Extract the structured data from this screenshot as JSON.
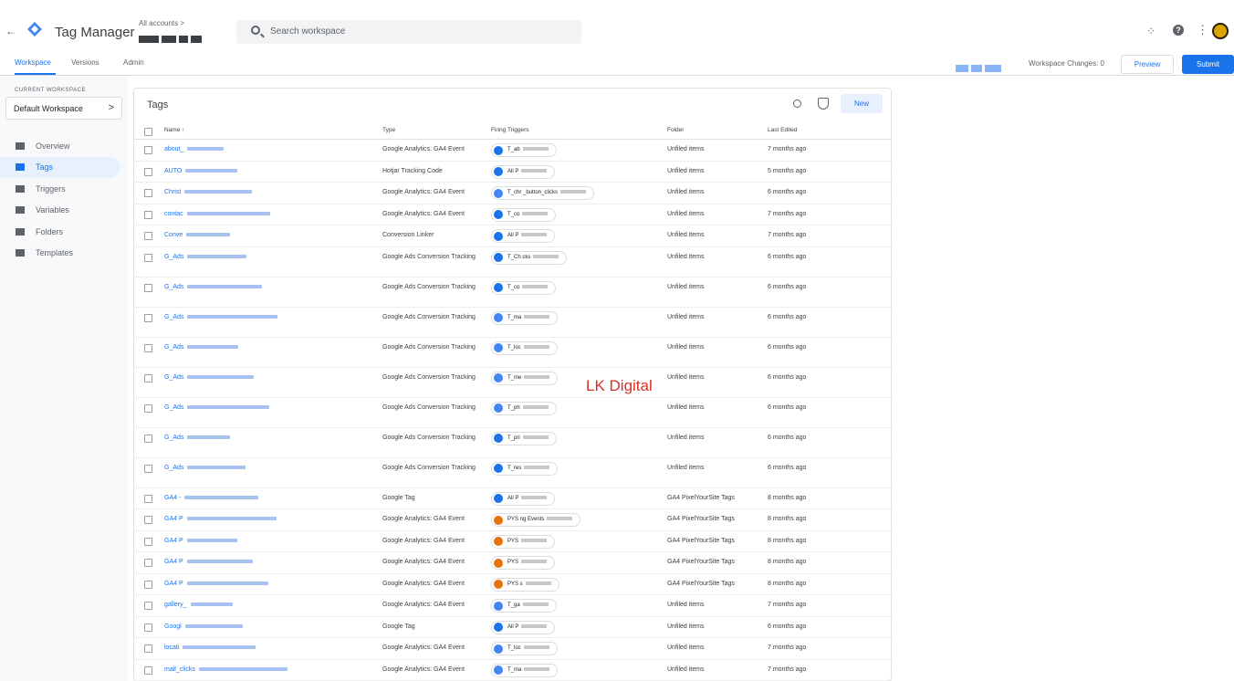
{
  "topbar": {
    "back_glyph": "←",
    "product_name": "Tag Manager",
    "account_path": "All accounts >",
    "search_placeholder": "Search workspace",
    "icons": [
      "back-arrow-icon",
      "tag-manager-logo",
      "search-icon",
      "apps-grid-icon",
      "help-icon",
      "more-vert-icon",
      "account-avatar"
    ]
  },
  "nav": {
    "tabs": [
      "Workspace",
      "Versions",
      "Admin"
    ],
    "active_tab": "Workspace",
    "workspace_changes": "Workspace Changes: 0",
    "preview_label": "Preview",
    "submit_label": "Submit"
  },
  "sidebar": {
    "current_workspace_label": "CURRENT WORKSPACE",
    "workspace_name": "Default Workspace",
    "chevron": ">",
    "items": [
      {
        "label": "Overview",
        "icon": "overview-icon",
        "active": false
      },
      {
        "label": "Tags",
        "icon": "tag-icon",
        "active": true
      },
      {
        "label": "Triggers",
        "icon": "trigger-icon",
        "active": false
      },
      {
        "label": "Variables",
        "icon": "variables-icon",
        "active": false
      },
      {
        "label": "Folders",
        "icon": "folder-icon",
        "active": false
      },
      {
        "label": "Templates",
        "icon": "template-icon",
        "active": false
      }
    ]
  },
  "panel": {
    "title": "Tags",
    "new_label": "New",
    "columns": [
      "Name ↑",
      "Type",
      "Firing Triggers",
      "Folder",
      "Last Edited"
    ]
  },
  "rows": [
    {
      "name": "about_",
      "type": "Google Analytics: GA4 Event",
      "trigger": "T_ab",
      "trigger_color": "blue",
      "folder": "Unfiled items",
      "edited": "7 months ago",
      "tall": false
    },
    {
      "name": "AUTO",
      "type": "Hotjar Tracking Code",
      "trigger": "All P",
      "trigger_color": "blue",
      "folder": "Unfiled items",
      "edited": "5 months ago",
      "tall": false
    },
    {
      "name": "Christ",
      "type": "Google Analytics: GA4 Event",
      "trigger": "T_chr _button_clicks",
      "trigger_color": "light",
      "folder": "Unfiled items",
      "edited": "6 months ago",
      "tall": false
    },
    {
      "name": "contac",
      "type": "Google Analytics: GA4 Event",
      "trigger": "T_co",
      "trigger_color": "blue",
      "folder": "Unfiled items",
      "edited": "7 months ago",
      "tall": false
    },
    {
      "name": "Conve",
      "type": "Conversion Linker",
      "trigger": "All P",
      "trigger_color": "blue",
      "folder": "Unfiled items",
      "edited": "7 months ago",
      "tall": false
    },
    {
      "name": "G_Ads",
      "type": "Google Ads Conversion Tracking",
      "trigger": "T_Ch cks",
      "trigger_color": "blue",
      "folder": "Unfiled items",
      "edited": "6 months ago",
      "tall": true
    },
    {
      "name": "G_Ads",
      "type": "Google Ads Conversion Tracking",
      "trigger": "T_co",
      "trigger_color": "blue",
      "folder": "Unfiled items",
      "edited": "6 months ago",
      "tall": true
    },
    {
      "name": "G_Ads",
      "type": "Google Ads Conversion Tracking",
      "trigger": "T_ma",
      "trigger_color": "light",
      "folder": "Unfiled items",
      "edited": "6 months ago",
      "tall": true
    },
    {
      "name": "G_Ads",
      "type": "Google Ads Conversion Tracking",
      "trigger": "T_loc",
      "trigger_color": "light",
      "folder": "Unfiled items",
      "edited": "6 months ago",
      "tall": true
    },
    {
      "name": "G_Ads",
      "type": "Google Ads Conversion Tracking",
      "trigger": "T_me",
      "trigger_color": "light",
      "folder": "Unfiled items",
      "edited": "6 months ago",
      "tall": true
    },
    {
      "name": "G_Ads",
      "type": "Google Ads Conversion Tracking",
      "trigger": "T_ph",
      "trigger_color": "light",
      "folder": "Unfiled items",
      "edited": "6 months ago",
      "tall": true
    },
    {
      "name": "G_Ads",
      "type": "Google Ads Conversion Tracking",
      "trigger": "T_pri",
      "trigger_color": "blue",
      "folder": "Unfiled items",
      "edited": "6 months ago",
      "tall": true
    },
    {
      "name": "G_Ads",
      "type": "Google Ads Conversion Tracking",
      "trigger": "T_res",
      "trigger_color": "blue",
      "folder": "Unfiled items",
      "edited": "6 months ago",
      "tall": true
    },
    {
      "name": "GA4 -",
      "type": "Google Tag",
      "trigger": "All P",
      "trigger_color": "blue",
      "folder": "GA4 PixelYourSite Tags",
      "edited": "8 months ago",
      "tall": false
    },
    {
      "name": "GA4 P",
      "type": "Google Analytics: GA4 Event",
      "trigger": "PYS ng Events",
      "trigger_color": "orange",
      "folder": "GA4 PixelYourSite Tags",
      "edited": "8 months ago",
      "tall": false
    },
    {
      "name": "GA4 P",
      "type": "Google Analytics: GA4 Event",
      "trigger": "PYS",
      "trigger_color": "orange",
      "folder": "GA4 PixelYourSite Tags",
      "edited": "8 months ago",
      "tall": false
    },
    {
      "name": "GA4 P",
      "type": "Google Analytics: GA4 Event",
      "trigger": "PYS",
      "trigger_color": "orange",
      "folder": "GA4 PixelYourSite Tags",
      "edited": "8 months ago",
      "tall": false
    },
    {
      "name": "GA4 P",
      "type": "Google Analytics: GA4 Event",
      "trigger": "PYS s",
      "trigger_color": "orange",
      "folder": "GA4 PixelYourSite Tags",
      "edited": "8 months ago",
      "tall": false
    },
    {
      "name": "gallery_",
      "type": "Google Analytics: GA4 Event",
      "trigger": "T_ga",
      "trigger_color": "light",
      "folder": "Unfiled items",
      "edited": "7 months ago",
      "tall": false
    },
    {
      "name": "Googl",
      "type": "Google Tag",
      "trigger": "All P",
      "trigger_color": "blue",
      "folder": "Unfiled items",
      "edited": "6 months ago",
      "tall": false
    },
    {
      "name": "locati",
      "type": "Google Analytics: GA4 Event",
      "trigger": "T_loc",
      "trigger_color": "light",
      "folder": "Unfiled items",
      "edited": "7 months ago",
      "tall": false
    },
    {
      "name": "mail_clicks",
      "type": "Google Analytics: GA4 Event",
      "trigger": "T_ma",
      "trigger_color": "light",
      "folder": "Unfiled items",
      "edited": "7 months ago",
      "tall": false
    }
  ],
  "watermark": "LK Digital",
  "colors": {
    "accent": "#1a73e8",
    "orange": "#e8710a",
    "sidebar_active": "#e8f0fe"
  }
}
